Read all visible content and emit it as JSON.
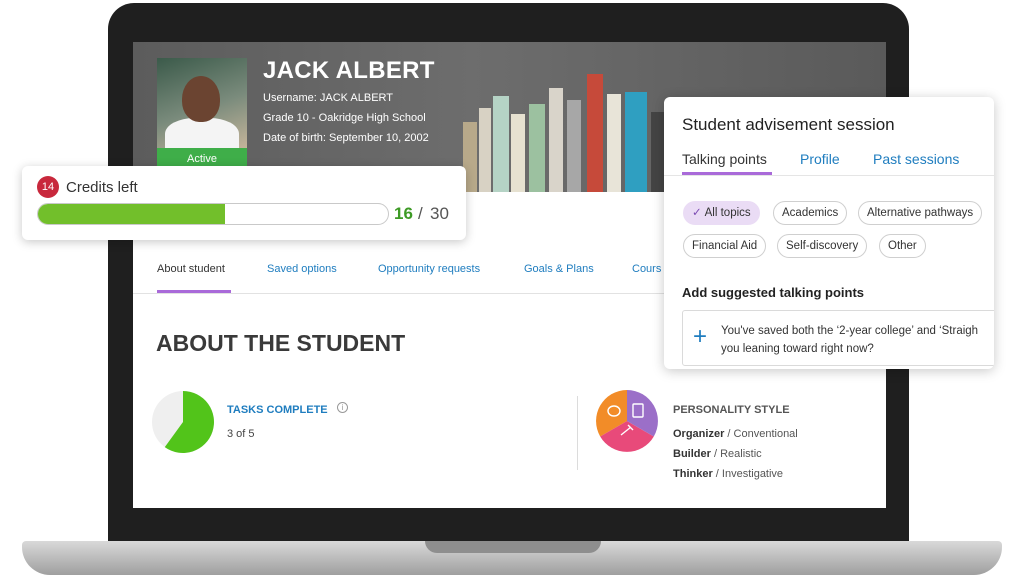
{
  "student": {
    "name": "JACK ALBERT",
    "status": "Active",
    "username": "Username: JACK ALBERT",
    "grade_school": "Grade 10 - Oakridge High School",
    "dob": "Date of birth: September 10, 2002"
  },
  "credits": {
    "badge": "14",
    "label": "Credits left",
    "used": 16,
    "total": 30,
    "used_text": "16",
    "separator": "/",
    "total_text": "30"
  },
  "tabs": [
    "About student",
    "Saved options",
    "Opportunity requests",
    "Goals & Plans",
    "Cours"
  ],
  "about": {
    "heading": "ABOUT THE STUDENT",
    "tasks_title": "TASKS COMPLETE",
    "tasks_count": "3 of 5",
    "tasks_completed": 3,
    "tasks_total": 5
  },
  "personality": {
    "title": "PERSONALITY STYLE",
    "items": [
      {
        "type": "Organizer",
        "sep": " / ",
        "desc": "Conventional"
      },
      {
        "type": "Builder",
        "sep": " / ",
        "desc": "Realistic"
      },
      {
        "type": "Thinker",
        "sep": " / ",
        "desc": "Investigative"
      }
    ]
  },
  "advisement": {
    "title": "Student advisement session",
    "tabs": [
      "Talking points",
      "Profile",
      "Past sessions"
    ],
    "chips": [
      "All topics",
      "Academics",
      "Alternative pathways",
      "Financial Aid",
      "Self-discovery",
      "Other"
    ],
    "suggest_title": "Add suggested talking points",
    "suggest_line1": "You've saved both the ‘2-year college’ and ‘Straigh",
    "suggest_line2": "you leaning toward right now?"
  },
  "colors": {
    "accent_purple": "#a96ad9",
    "link_blue": "#1f7dbf",
    "progress_green": "#72bf2b",
    "badge_red": "#c8283c",
    "active_green": "#3fae49",
    "pie_green": "#52c41a",
    "wheel_orange": "#f28c28",
    "wheel_purple": "#9b6fc8",
    "wheel_pink": "#e84a7a"
  }
}
